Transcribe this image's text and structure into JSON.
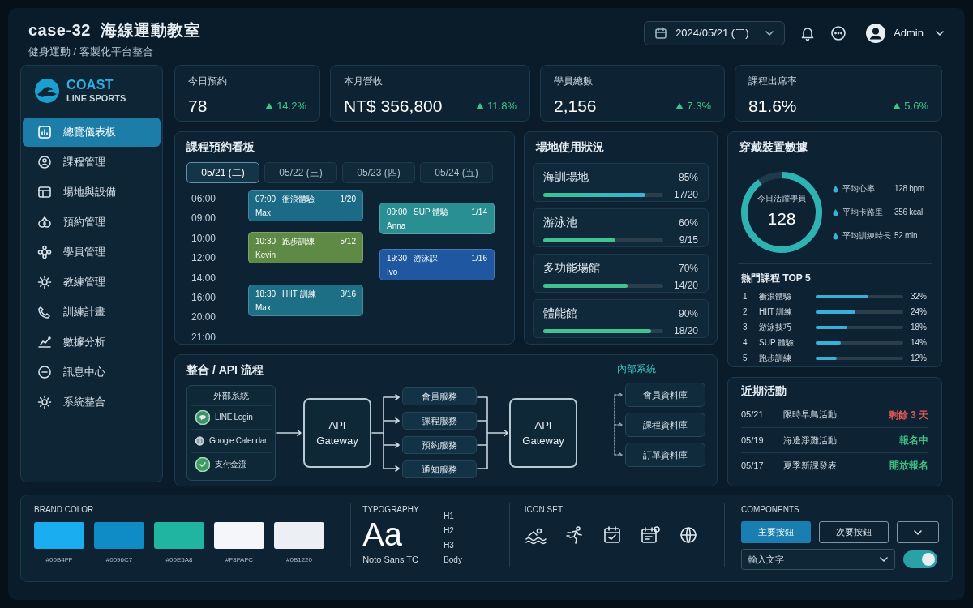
{
  "header": {
    "title": "case-32  海線運動教室",
    "subtitle": "健身運動 / 客製化平台整合",
    "date": "2024/05/21 (二)",
    "user": "Admin"
  },
  "sidebar": {
    "brand": "COAST",
    "brand_sub": "LINE SPORTS",
    "items": [
      {
        "label": "總覽儀表板",
        "selected": true
      },
      {
        "label": "課程管理",
        "selected": false
      },
      {
        "label": "場地與設備",
        "selected": false
      },
      {
        "label": "預約管理",
        "selected": false
      },
      {
        "label": "學員管理",
        "selected": false
      },
      {
        "label": "教練管理",
        "selected": false
      },
      {
        "label": "訓練計畫",
        "selected": false
      },
      {
        "label": "數據分析",
        "selected": false
      },
      {
        "label": "訊息中心",
        "selected": false
      },
      {
        "label": "系統整合",
        "selected": false
      }
    ]
  },
  "kpis": [
    {
      "label": "今日預約",
      "value": "78",
      "change": "14.2%"
    },
    {
      "label": "本月營收",
      "value": "NT$ 356,800",
      "change": "11.8%"
    },
    {
      "label": "學員總數",
      "value": "2,156",
      "change": "7.3%"
    },
    {
      "label": "課程出席率",
      "value": "81.6%",
      "change": "5.6%"
    }
  ],
  "schedule": {
    "title": "課程預約看板",
    "days": [
      {
        "label": "05/21 (二)",
        "selected": true
      },
      {
        "label": "05/22 (三)",
        "selected": false
      },
      {
        "label": "05/23 (四)",
        "selected": false
      },
      {
        "label": "05/24 (五)",
        "selected": false
      }
    ],
    "times": [
      "06:00",
      "09:00",
      "10:00",
      "12:00",
      "14:00",
      "16:00",
      "20:00",
      "21:00"
    ],
    "columns": [
      [
        {
          "time": "07:00",
          "name": "衝浪體驗",
          "count": "1/20",
          "coach": "Max",
          "color": "#1b6a86"
        },
        {
          "time": "10:30",
          "name": "跑步訓練",
          "count": "5/12",
          "coach": "Kevin",
          "color": "#5f8a45"
        },
        {
          "time": "18:30",
          "name": "HIIT 訓練",
          "count": "3/16",
          "coach": "Max",
          "color": "#1d6f86"
        }
      ],
      [
        {
          "time": "09:00",
          "name": "SUP 體驗",
          "count": "1/14",
          "coach": "Anna",
          "color": "#2a8f92"
        },
        {
          "time": "19:30",
          "name": "游泳課",
          "count": "1/16",
          "coach": "Ivo",
          "color": "#1f58a0"
        }
      ]
    ]
  },
  "venues": {
    "title": "場地使用狀況",
    "items": [
      {
        "name": "海訓場地",
        "percent": "85%",
        "level": 0.85,
        "count": "17/20"
      },
      {
        "name": "游泳池",
        "percent": "60%",
        "level": 0.6,
        "count": "9/15"
      },
      {
        "name": "多功能場館",
        "percent": "70%",
        "level": 0.7,
        "count": "14/20"
      },
      {
        "name": "體能館",
        "percent": "90%",
        "level": 0.9,
        "count": "18/20"
      }
    ]
  },
  "wearables": {
    "title": "穿戴裝置數據",
    "ring_label": "今日活躍學員",
    "ring_value": "128",
    "level": 0.9,
    "stats": [
      {
        "label": "平均心率",
        "value": "128 bpm"
      },
      {
        "label": "平均卡路里",
        "value": "356 kcal"
      },
      {
        "label": "平均訓練時長",
        "value": "52 min"
      }
    ],
    "top_title": "熱門課程 TOP 5",
    "top": [
      {
        "rank": "1",
        "name": "衝浪體驗",
        "percent": "32%",
        "level": 0.6
      },
      {
        "rank": "2",
        "name": "HIIT 訓練",
        "percent": "24%",
        "level": 0.45
      },
      {
        "rank": "3",
        "name": "游泳技巧",
        "percent": "18%",
        "level": 0.36
      },
      {
        "rank": "4",
        "name": "SUP 體驗",
        "percent": "14%",
        "level": 0.29
      },
      {
        "rank": "5",
        "name": "跑步訓練",
        "percent": "12%",
        "level": 0.24
      }
    ]
  },
  "integration": {
    "title": "整合 / API 流程",
    "external_title": "外部系統",
    "external": [
      "LINE Login",
      "Google Calendar",
      "支付金流"
    ],
    "gateway_in": "API Gateway",
    "services": [
      "會員服務",
      "課程服務",
      "預約服務",
      "通知服務"
    ],
    "gateway_out": "API Gateway",
    "internal_title": "內部系統",
    "internal": [
      "會員資料庫",
      "課程資料庫",
      "訂單資料庫"
    ]
  },
  "events": {
    "title": "近期活動",
    "items": [
      {
        "date": "05/21",
        "name": "限時早鳥活動",
        "status": "剩餘 3 天",
        "color": "#e05858"
      },
      {
        "date": "05/19",
        "name": "海邊淨灘活動",
        "status": "報名中",
        "color": "#3fbf83"
      },
      {
        "date": "05/17",
        "name": "夏季新課發表",
        "status": "開放報名",
        "color": "#3fbf83"
      }
    ]
  },
  "design": {
    "brand_title": "BRAND COLOR",
    "swatches": [
      {
        "label": "#00B4FF",
        "color": "#1aaef0"
      },
      {
        "label": "#0096C7",
        "color": "#0f8cc6"
      },
      {
        "label": "#00E5A8",
        "color": "#1fb5a0"
      },
      {
        "label": "#F8FAFC",
        "color": "#f4f6f9"
      },
      {
        "label": "#0B1220",
        "color": "#eceff3"
      }
    ],
    "type_title": "TYPOGRAPHY",
    "type_sample": "Aa",
    "type_font": "Noto Sans TC",
    "type_levels": [
      "H1",
      "H2",
      "H3",
      "Body"
    ],
    "icon_title": "ICON SET",
    "components_title": "COMPONENTS",
    "primary_button": "主要按鈕",
    "secondary_button": "次要按鈕",
    "select": {
      "placeholder": "輸入文字"
    },
    "toggle": {
      "on": true
    }
  }
}
